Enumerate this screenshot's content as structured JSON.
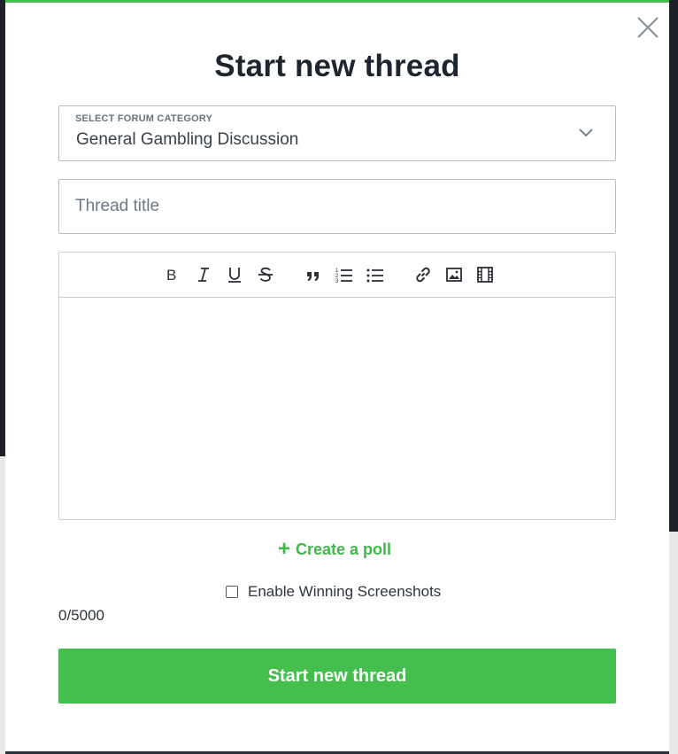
{
  "modal": {
    "title": "Start new thread",
    "close_icon": "close-icon"
  },
  "category_select": {
    "label": "SELECT FORUM CATEGORY",
    "value": "General Gambling Discussion",
    "icon": "chevron-down-icon"
  },
  "thread_title": {
    "value": "",
    "placeholder": "Thread title"
  },
  "editor": {
    "toolbar": [
      {
        "name": "bold-icon"
      },
      {
        "name": "italic-icon"
      },
      {
        "name": "underline-icon"
      },
      {
        "name": "strikethrough-icon"
      },
      {
        "name": "blockquote-icon"
      },
      {
        "name": "ordered-list-icon"
      },
      {
        "name": "bullet-list-icon"
      },
      {
        "name": "link-icon"
      },
      {
        "name": "image-icon"
      },
      {
        "name": "video-icon"
      }
    ],
    "content": ""
  },
  "poll": {
    "label": "Create a poll",
    "icon": "plus-icon"
  },
  "winning_screenshots": {
    "label": "Enable Winning Screenshots",
    "checked": false
  },
  "char_counter": "0/5000",
  "submit": {
    "label": "Start new thread"
  },
  "colors": {
    "accent": "#44bf4e",
    "title_text": "#1e252e"
  }
}
